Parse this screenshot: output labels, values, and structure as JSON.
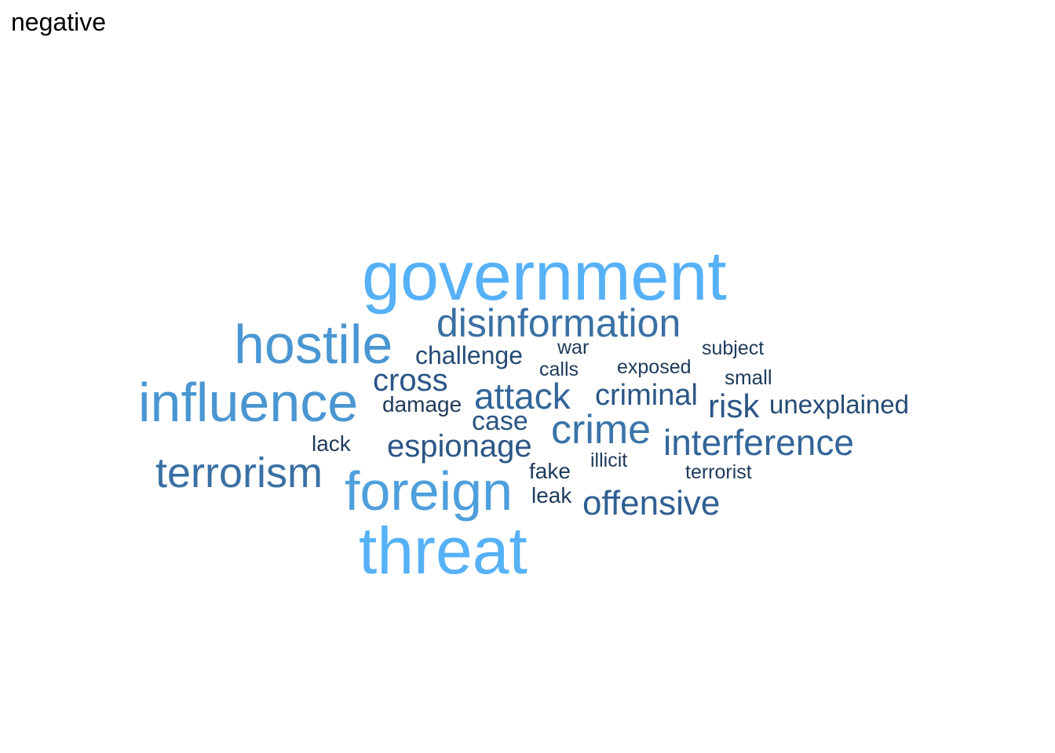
{
  "title": "negative",
  "palette": {
    "largest": "#56B1F7",
    "large": "#4A9AD9",
    "medium": "#3A78B0",
    "small": "#2E5B87",
    "smallest": "#1E3A5A"
  },
  "words": [
    {
      "text": "government",
      "color": "#56B1F7"
    },
    {
      "text": "threat",
      "color": "#56B1F7"
    },
    {
      "text": "foreign",
      "color": "#4E9FDC"
    },
    {
      "text": "influence",
      "color": "#4A96D2"
    },
    {
      "text": "hostile",
      "color": "#4A96D2"
    },
    {
      "text": "disinformation",
      "color": "#3A70A3"
    },
    {
      "text": "terrorism",
      "color": "#3A70A3"
    },
    {
      "text": "crime",
      "color": "#3A74AA"
    },
    {
      "text": "interference",
      "color": "#336599"
    },
    {
      "text": "attack",
      "color": "#336599"
    },
    {
      "text": "offensive",
      "color": "#2F5F92"
    },
    {
      "text": "espionage",
      "color": "#2B5686"
    },
    {
      "text": "cross",
      "color": "#2B5686"
    },
    {
      "text": "risk",
      "color": "#2B5686"
    },
    {
      "text": "criminal",
      "color": "#2B5686"
    },
    {
      "text": "case",
      "color": "#2A5483"
    },
    {
      "text": "challenge",
      "color": "#254B76"
    },
    {
      "text": "unexplained",
      "color": "#254B76"
    },
    {
      "text": "damage",
      "color": "#1E3A5A"
    },
    {
      "text": "lack",
      "color": "#1E3A5A"
    },
    {
      "text": "fake",
      "color": "#1E3A5A"
    },
    {
      "text": "leak",
      "color": "#1E3A5A"
    },
    {
      "text": "war",
      "color": "#1E3A5A"
    },
    {
      "text": "calls",
      "color": "#1E3A5A"
    },
    {
      "text": "exposed",
      "color": "#1E3A5A"
    },
    {
      "text": "subject",
      "color": "#1E3A5A"
    },
    {
      "text": "small",
      "color": "#1E3A5A"
    },
    {
      "text": "illicit",
      "color": "#1E3A5A"
    },
    {
      "text": "terrorist",
      "color": "#1E3A5A"
    }
  ]
}
